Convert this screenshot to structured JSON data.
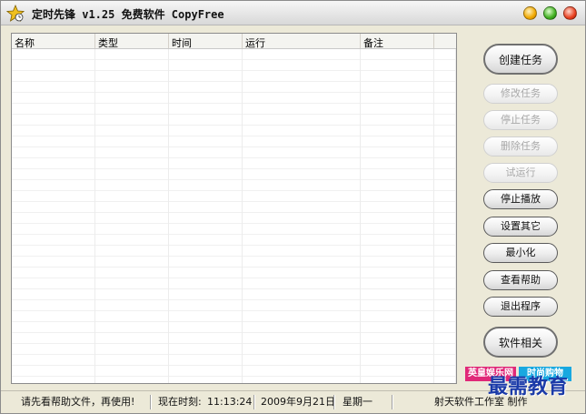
{
  "window": {
    "title": "定时先锋 v1.25  免费软件 CopyFree"
  },
  "task_list": {
    "columns": [
      "名称",
      "类型",
      "时间",
      "运行",
      "备注",
      ""
    ]
  },
  "buttons": {
    "create_task": "创建任务",
    "modify_task": "修改任务",
    "stop_task": "停止任务",
    "delete_task": "删除任务",
    "test_run": "试运行",
    "stop_playback": "停止播放",
    "other_settings": "设置其它",
    "minimize": "最小化",
    "view_help": "查看帮助",
    "exit_program": "退出程序",
    "software_related": "软件相关"
  },
  "logos": {
    "left": "英皇娱乐网",
    "right": "时尚购物"
  },
  "status": {
    "hint": "请先看帮助文件，再使用!",
    "time_label": "现在时刻:",
    "time_value": "11:13:24",
    "date": "2009年9月21日",
    "weekday": "星期一",
    "credit": "射天软件工作室 制作"
  },
  "watermark": "最需教育",
  "colors": {
    "window_bg": "#ece9d8",
    "logo_left": "#e02878",
    "logo_right": "#18a8e0",
    "watermark": "#1a3aa8"
  }
}
